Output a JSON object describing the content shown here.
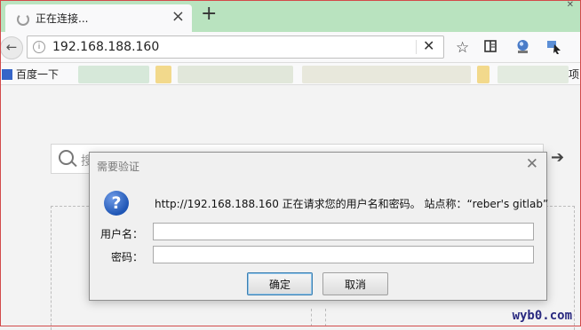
{
  "browser": {
    "tab": {
      "title": "正在连接..."
    },
    "url": "192.168.188.160",
    "bookmarks": {
      "first_label": "百度一下",
      "trailing_fragment": "项"
    }
  },
  "page": {
    "search_hint_fragment": "搜"
  },
  "dialog": {
    "title": "需要验证",
    "message": "http://192.168.188.160 正在请求您的用户名和密码。 站点称：“reber's gitlab”",
    "username_label": "用户名：",
    "password_label": "密码：",
    "username_value": "",
    "password_value": "",
    "ok_label": "确定",
    "cancel_label": "取消"
  },
  "watermark": "wyb0.com"
}
